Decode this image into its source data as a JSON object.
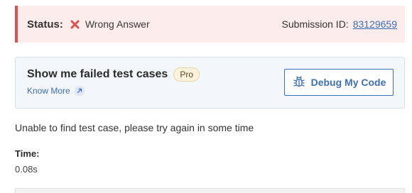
{
  "status": {
    "label": "Status:",
    "result_text": "Wrong Answer",
    "result_icon": "x-icon",
    "result_color": "#d9534f",
    "submission_label": "Submission ID:",
    "submission_id": "83129659"
  },
  "failed_tests": {
    "heading": "Show me failed test cases",
    "badge": "Pro",
    "know_more": "Know More",
    "know_more_icon": "arrow-up-right-icon",
    "debug_button": "Debug My Code",
    "debug_icon": "bug-icon"
  },
  "message": "Unable to find test case, please try again in some time",
  "time": {
    "label": "Time:",
    "value": "0.08s"
  },
  "colors": {
    "accent": "#3d6fb4",
    "error_bg": "#fcecec",
    "card_bg": "#f3f6fb"
  }
}
